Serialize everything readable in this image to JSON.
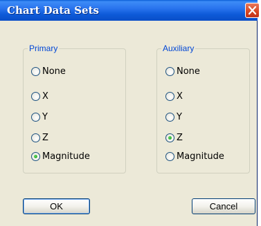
{
  "dialog": {
    "title": "Chart Data Sets"
  },
  "primary": {
    "legend": "Primary",
    "options": [
      "None",
      "X",
      "Y",
      "Z",
      "Magnitude"
    ],
    "selected": "Magnitude"
  },
  "auxiliary": {
    "legend": "Auxiliary",
    "options": [
      "None",
      "X",
      "Y",
      "Z",
      "Magnitude"
    ],
    "selected": "Z"
  },
  "buttons": {
    "ok": "OK",
    "cancel": "Cancel"
  },
  "icons": {
    "close": "close-icon"
  }
}
